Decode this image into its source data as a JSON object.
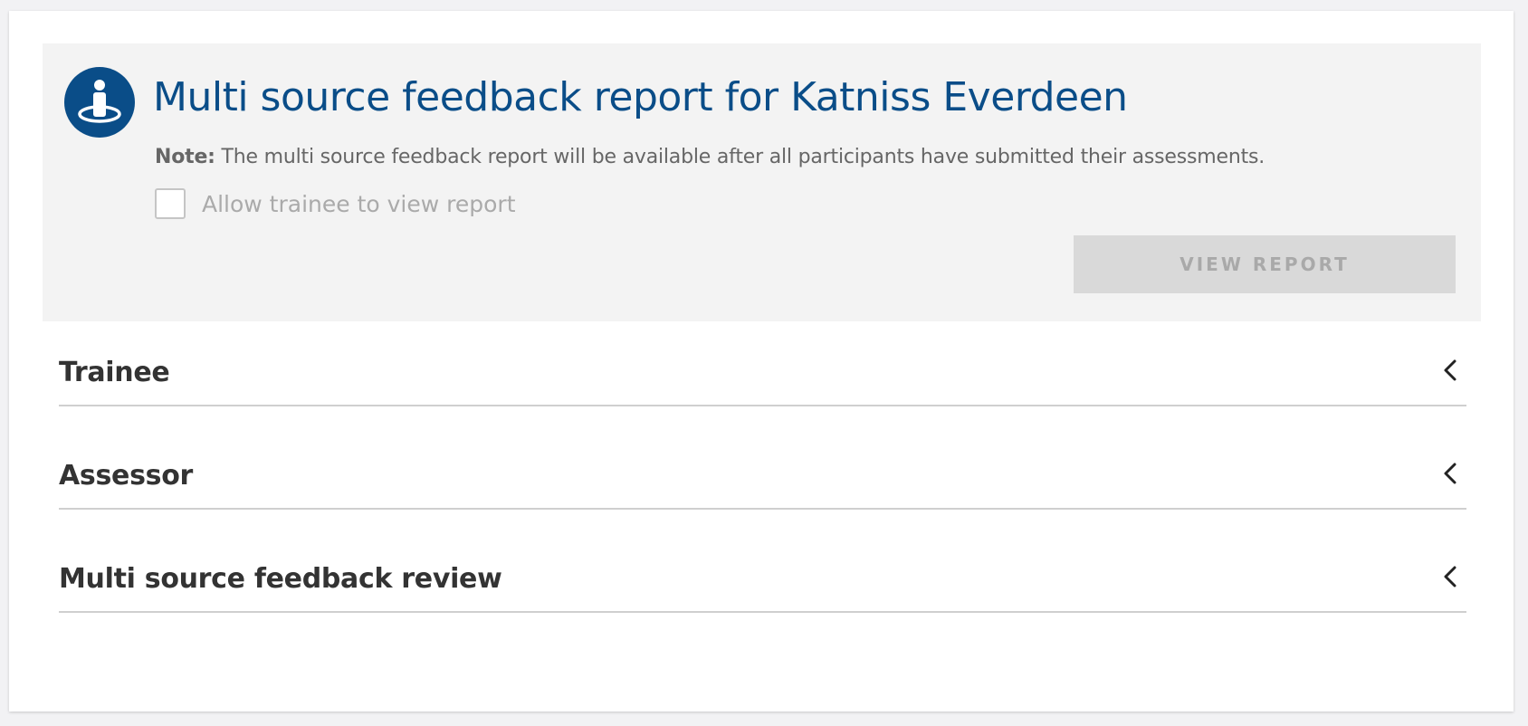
{
  "header": {
    "title": "Multi source feedback report for Katniss Everdeen",
    "note_prefix": "Note:",
    "note_text": " The multi source feedback report will be available after all participants have submitted their assessments.",
    "allow_trainee_label": "Allow trainee to view report",
    "allow_trainee_checked": false,
    "view_report_label": "VIEW REPORT",
    "icon": "person-target-icon"
  },
  "sections": [
    {
      "label": "Trainee",
      "icon": "chevron-left-icon"
    },
    {
      "label": "Assessor",
      "icon": "chevron-left-icon"
    },
    {
      "label": "Multi source feedback review",
      "icon": "chevron-left-icon"
    }
  ],
  "colors": {
    "brand": "#0a4d88",
    "panel_bg": "#f3f3f3",
    "button_disabled_bg": "#d9d9d9",
    "text_dark": "#333333"
  }
}
